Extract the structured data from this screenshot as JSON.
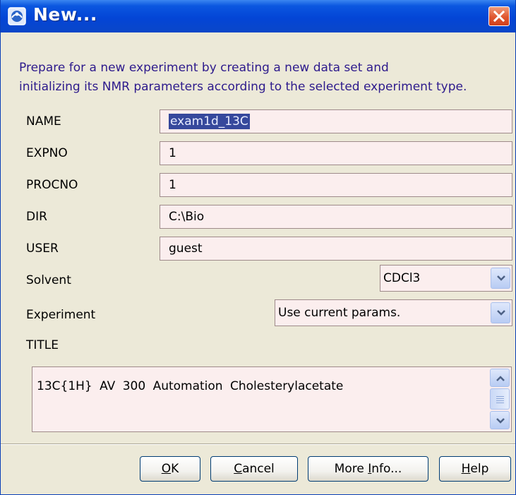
{
  "window": {
    "title": "New...",
    "description_line1": "Prepare for a new experiment by creating a new data set and",
    "description_line2": "initializing its NMR parameters according to the selected experiment type."
  },
  "fields": {
    "name": {
      "label": "NAME",
      "value": "exam1d_13C"
    },
    "expno": {
      "label": "EXPNO",
      "value": "1"
    },
    "procno": {
      "label": "PROCNO",
      "value": "1"
    },
    "dir": {
      "label": "DIR",
      "value": "C:\\Bio"
    },
    "user": {
      "label": "USER",
      "value": "guest"
    },
    "solvent": {
      "label": "Solvent",
      "value": "CDCl3"
    },
    "experiment": {
      "label": "Experiment",
      "value": "Use current params."
    },
    "title": {
      "label": "TITLE",
      "value": "13C{1H}  AV 300 Automation  Cholesterylacetate"
    }
  },
  "buttons": {
    "ok": {
      "mnemonic": "O",
      "rest": "K"
    },
    "cancel": {
      "mnemonic": "C",
      "rest": "ancel"
    },
    "more_info": {
      "pre": "More ",
      "mnemonic": "I",
      "rest": "nfo..."
    },
    "help": {
      "mnemonic": "H",
      "rest": "elp"
    }
  },
  "icons": {
    "app": "bruker-app-icon",
    "close": "close-icon",
    "dropdown": "chevron-down-icon",
    "scroll_up": "chevron-up-icon",
    "scroll_down": "chevron-down-icon"
  },
  "colors": {
    "titlebar": "#0a46c8",
    "close_button": "#e0562f",
    "description_text": "#2d1a8c",
    "field_background": "#fbeeee",
    "selection": "#36489c"
  }
}
